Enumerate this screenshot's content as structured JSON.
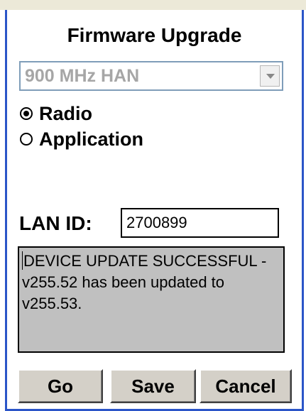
{
  "dialog": {
    "title": "Firmware Upgrade"
  },
  "module_select": {
    "value": "900 MHz HAN"
  },
  "target": {
    "options": [
      {
        "label": "Radio",
        "selected": true
      },
      {
        "label": "Application",
        "selected": false
      }
    ]
  },
  "lan": {
    "label": "LAN ID:",
    "value": "2700899"
  },
  "status": {
    "message": "DEVICE UPDATE SUCCESSFUL - v255.52 has been updated to v255.53."
  },
  "buttons": {
    "go": "Go",
    "save": "Save",
    "cancel": "Cancel"
  },
  "colors": {
    "frame": "#2B55C8",
    "status_bg": "#C0C0C0",
    "button_face": "#D4D0C8"
  }
}
